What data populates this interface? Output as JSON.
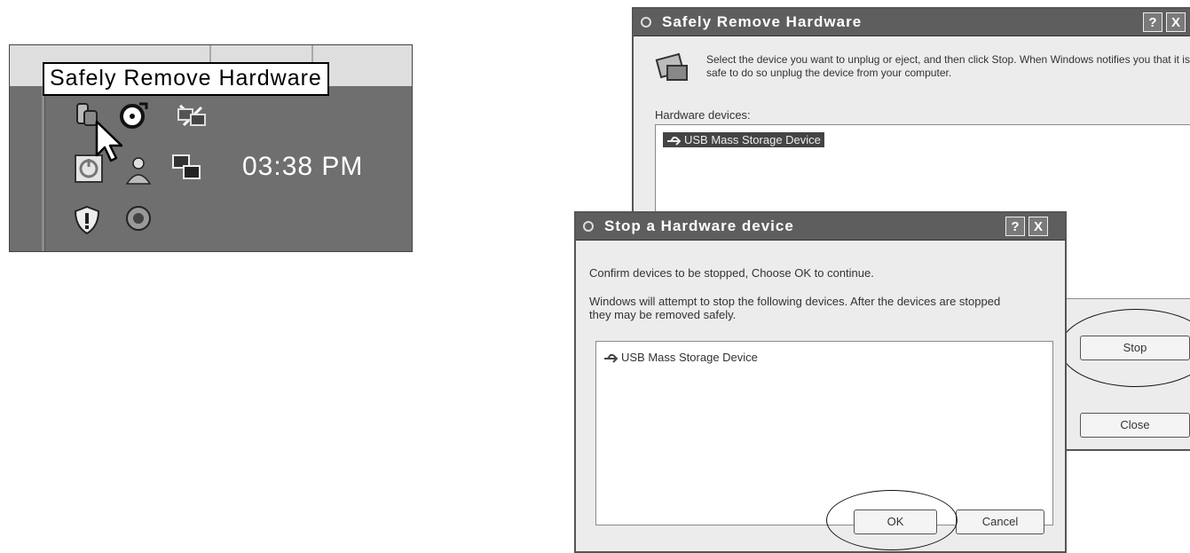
{
  "tray": {
    "tooltip": "Safely Remove Hardware",
    "clock": "03:38 PM",
    "icons": [
      "hardware-remove-icon",
      "cd-icon",
      "network-icon",
      "power-icon",
      "user-icon",
      "monitor-icon",
      "shield-icon",
      "speaker-icon"
    ]
  },
  "safe_remove_dialog": {
    "title": "Safely Remove Hardware",
    "instruction": "Select the device you want to unplug or eject, and then click Stop. When Windows notifies you that it is safe to do so unplug the device from your computer.",
    "devices_label": "Hardware devices:",
    "device_item": "USB Mass Storage Device",
    "stop_label": "Stop",
    "close_label": "Close",
    "help_label": "?",
    "close_x": "X"
  },
  "stop_dialog": {
    "title": "Stop a Hardware device",
    "confirm_text": "Confirm devices to be stopped, Choose OK to continue.",
    "warning_text": "Windows will attempt to stop the following devices. After the devices are stopped they may be removed safely.",
    "device_item": "USB Mass Storage Device",
    "ok_label": "OK",
    "cancel_label": "Cancel",
    "help_label": "?",
    "close_x": "X"
  }
}
